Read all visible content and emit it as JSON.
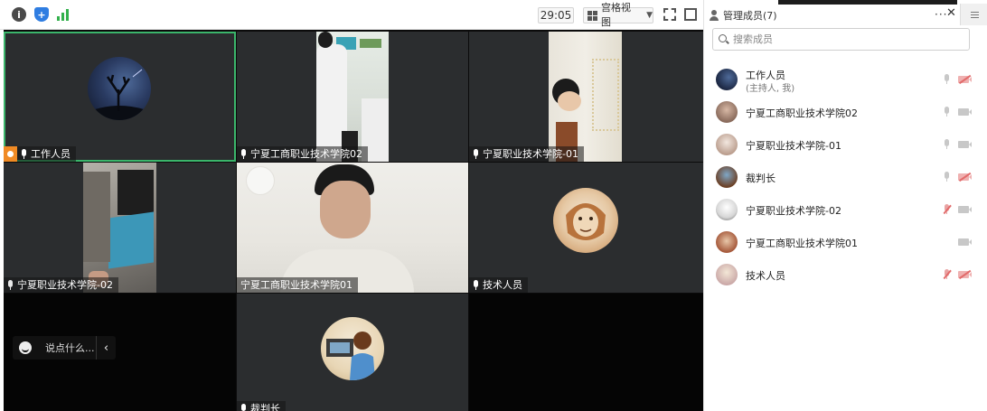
{
  "toolbar": {
    "info_icon": "info-icon",
    "security_icon": "shield-icon",
    "signal_icon": "signal-bars-icon",
    "timer": "29:05",
    "view_mode_label": "宫格视图",
    "fullscreen_icon": "fullscreen-icon",
    "side_panel_icon": "panel-toggle-icon"
  },
  "video_tiles": [
    {
      "label": "工作人员",
      "host": true,
      "active": true
    },
    {
      "label": "宁夏工商职业技术学院02"
    },
    {
      "label": "宁夏职业技术学院-01"
    },
    {
      "label": "宁夏职业技术学院-02"
    },
    {
      "label": "宁夏工商职业技术学院01"
    },
    {
      "label": "技术人员"
    },
    {
      "label": ""
    },
    {
      "label": "裁判长"
    },
    {
      "label": ""
    }
  ],
  "chat": {
    "placeholder": "说点什么..."
  },
  "panel": {
    "title": "管理成员(7)",
    "search_placeholder": "搜索成员",
    "members": [
      {
        "name": "工作人员",
        "role": "(主持人, 我)",
        "mic": "on",
        "camera": "off"
      },
      {
        "name": "宁夏工商职业技术学院02",
        "mic": "on",
        "camera": "on"
      },
      {
        "name": "宁夏职业技术学院-01",
        "mic": "on",
        "camera": "on"
      },
      {
        "name": "裁判长",
        "mic": "on",
        "camera": "off"
      },
      {
        "name": "宁夏职业技术学院-02",
        "mic": "off",
        "camera": "on"
      },
      {
        "name": "宁夏工商职业技术学院01",
        "mic": "none",
        "camera": "on"
      },
      {
        "name": "技术人员",
        "mic": "off",
        "camera": "off"
      }
    ]
  },
  "colors": {
    "active_speaker": "#3bb56b",
    "host_badge": "#f08a24",
    "muted": "#e26b6b"
  }
}
